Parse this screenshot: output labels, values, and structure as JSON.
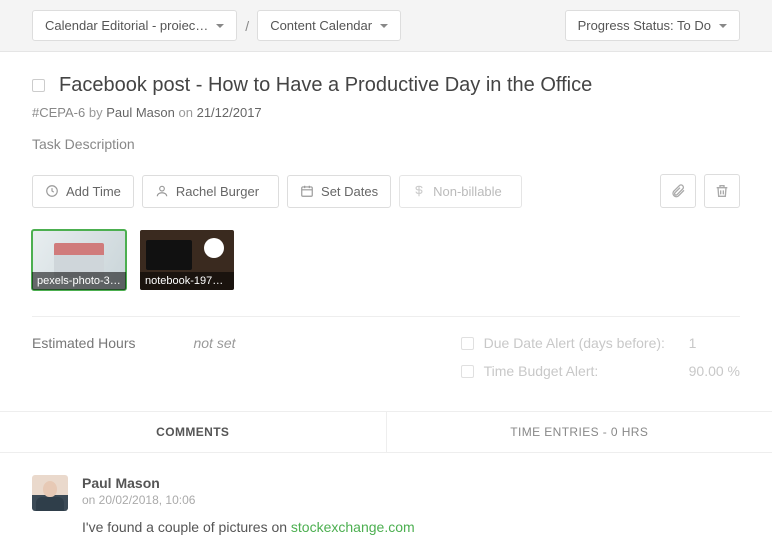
{
  "topbar": {
    "project": "Calendar Editorial - proiec…",
    "calendar": "Content Calendar",
    "status": "Progress Status: To Do"
  },
  "task": {
    "title": "Facebook post - How to Have a Productive Day in the Office",
    "id": "#CEPA-6",
    "by_word": "by",
    "author": "Paul Mason",
    "on_word": "on",
    "date": "21/12/2017",
    "description_placeholder": "Task Description"
  },
  "toolbar": {
    "add_time": "Add Time",
    "assignee": "Rachel Burger",
    "set_dates": "Set Dates",
    "billable": "Non-billable"
  },
  "attachments": [
    {
      "name": "pexels-photo-3…"
    },
    {
      "name": "notebook-1971…"
    }
  ],
  "estimate": {
    "label": "Estimated Hours",
    "value": "not set"
  },
  "alerts": {
    "due_label": "Due Date Alert (days before):",
    "due_value": "1",
    "budget_label": "Time Budget Alert:",
    "budget_value": "90.00 %"
  },
  "tabs": {
    "comments": "COMMENTS",
    "time": "TIME ENTRIES - 0 HRS"
  },
  "comments": [
    {
      "author": "Paul Mason",
      "when": "on 20/02/2018, 10:06",
      "text_prefix": "I've found a couple of pictures on ",
      "link": "stockexchange.com"
    }
  ]
}
